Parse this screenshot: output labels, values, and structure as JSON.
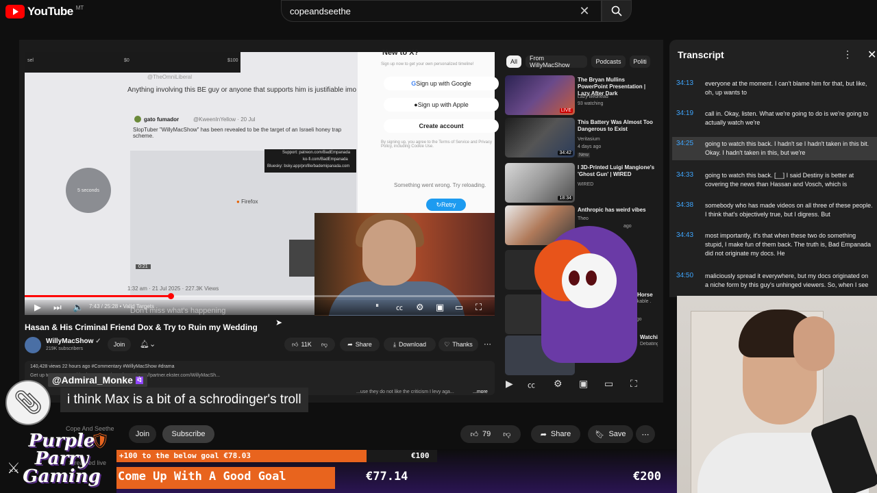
{
  "youtube": {
    "logo_text": "YouTube",
    "logo_region": "MT",
    "search_query": "copeandseethe"
  },
  "player": {
    "tweet_top_left": "sel",
    "tweet_top_mid": "$0",
    "tweet_top_right": "$100",
    "tweet_handle": "@TheOmniLiberal",
    "tweet_text": "Anything involving this BE guy or anyone that supports him is justifiable imo",
    "quoted_user": "gato fumador",
    "quoted_handle": "@KweenInYellow · 20 Jul",
    "quoted_text": "SlopTuber \"WillyMacShow\" has been revealed to be the target of an Israeli honey trap scheme.",
    "support_text_1": "Support: patreon.com/BadEmpanada",
    "support_text_2": "ko-fi.com/BadEmpanada",
    "support_text_3": "Bluesky: bsky.app/profile/bademipanada.com",
    "circle_text": "5 seconds",
    "firefox_label": "Firefox",
    "inner_time": "0:21",
    "date_views": "1:32 am · 21 Jul 2025 · 227.3K Views",
    "x_title": "New to X?",
    "x_sub": "Sign up now to get your own personalized timeline!",
    "x_google": "Sign up with Google",
    "x_apple": "Sign up with Apple",
    "x_create": "Create account",
    "x_terms": "By signing up, you agree to the Terms of Service and Privacy Policy, including Cookie Use.",
    "x_error": "Something went wrong. Try reloading.",
    "x_retry": "Retry",
    "progress_fraction": 0.31,
    "time_display": "7:43 / 25:28 • Valid Targets",
    "subtitle_ghost": "Don't miss what's happening"
  },
  "video": {
    "title": "Hasan & His Criminal Friend Dox & Try to Ruin my Wedding",
    "channel": "WillyMacShow",
    "subscribers": "219K subscribers",
    "join_label": "Join",
    "likes": "11K",
    "share_label": "Share",
    "download_label": "Download",
    "thanks_label": "Thanks",
    "desc_line1": "140,428 views  22 hours ago  #Commentary #WillyMacShow #drama",
    "desc_line2": "Get up to 70% OFF with Ekster NOW by going to https://partner.ekster.com/WillyMacSh...",
    "desc_line3": "...use they do not like the criticism I levy aga...",
    "desc_more": "...more"
  },
  "chips": [
    "All",
    "From WillyMacShow",
    "Podcasts",
    "Politi"
  ],
  "recommendations": [
    {
      "title": "The Bryan Mullins PowerPoint Presentation | Lazy After Dark",
      "meta1": "Lazy Bedhead",
      "meta2": "93 watching",
      "badge": "LIVE"
    },
    {
      "title": "This Battery Was Almost Too Dangerous to Exist",
      "meta1": "Veritasium",
      "meta2": "4 days ago",
      "badge": "New",
      "duration": "34:42"
    },
    {
      "title": "I 3D-Printed Luigi Mangione's 'Ghost Gun' | WIRED",
      "meta1": "WIRED",
      "meta2": "",
      "duration": "18:34"
    },
    {
      "title": "Anthropic has weird vibes",
      "meta1": "Theo",
      "meta2": "ago",
      "duration": ""
    },
    {
      "title": "Horse",
      "meta1": "unkable .",
      "meta2": "",
      "duration": ""
    },
    {
      "title": "Watching th",
      "meta1": "Debating Mi",
      "meta2": "months ago",
      "duration": ""
    }
  ],
  "transcript": {
    "title": "Transcript",
    "rows": [
      {
        "time": "34:13",
        "text": "everyone at the moment. I can't blame him for that, but like, oh, up wants to"
      },
      {
        "time": "34:19",
        "text": "call in. Okay, listen. What we're going to do is we're going to actually watch we're"
      },
      {
        "time": "34:25",
        "text": "going to watch this back. I hadn't se I hadn't taken in this bit. Okay. I hadn't taken in this, but we're",
        "highlight": true
      },
      {
        "time": "34:33",
        "text": "going to watch this back. [__] I said Destiny is better at covering the news than Hassan and Vosch, which is"
      },
      {
        "time": "34:38",
        "text": "somebody who has made videos on all three of these people. I think that's objectively true, but I digress. But"
      },
      {
        "time": "34:43",
        "text": "most importantly, it's that when these two do something stupid, I make fun of them back. The truth is, Bad Empanada did not originate my docs. He"
      },
      {
        "time": "34:50",
        "text": "maliciously spread it everywhere, but my docs originated on a niche form by this guy's unhinged viewers. So, when I see"
      }
    ]
  },
  "chat": {
    "username": "@Admiral_Monke",
    "message": "i think Max is a bit of a schrodinger's troll"
  },
  "stream_bar": {
    "join_label": "Join",
    "subscribe_label": "Subscribe",
    "like_count": "79",
    "share_label": "Share",
    "save_label": "Save",
    "channel_ghost": "Cope And Seethe",
    "streamed_ghost": "Streamed live"
  },
  "branding": {
    "line1": "Purple",
    "line2": "Parry",
    "line3": "Gaming"
  },
  "goals": {
    "goal1_text": "+100 to the below goal €78.03",
    "goal1_target": "€100",
    "goal1_fraction": 0.78,
    "goal2_text": "Come Up With A Good Goal",
    "goal2_amount": "€77.14",
    "goal2_target": "€200",
    "goal2_fraction": 0.39
  },
  "colors": {
    "accent_red": "#ff0000",
    "goal_orange": "#e8641e",
    "transcript_time": "#3ea6ff",
    "brand_purple": "#6a3aa6"
  }
}
